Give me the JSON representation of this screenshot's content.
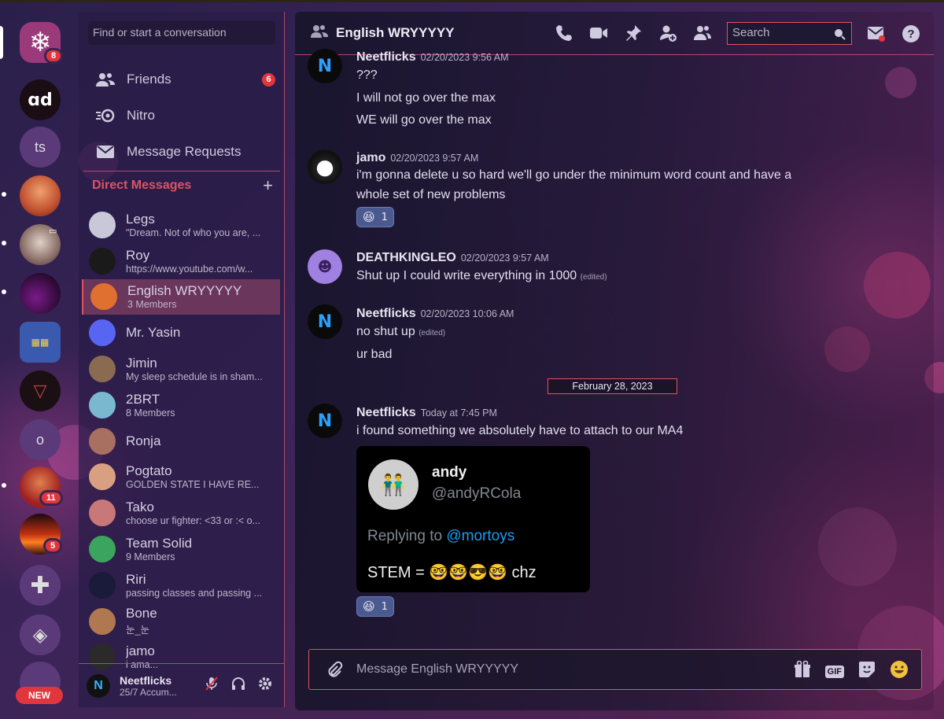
{
  "servers": {
    "home_badge": "8",
    "ts_label": "ts",
    "o_label": "o",
    "srv9_badge": "11",
    "srv10_badge": "5",
    "new_label": "NEW"
  },
  "search_placeholder": "Find or start a conversation",
  "nav": {
    "friends": "Friends",
    "friends_badge": "6",
    "nitro": "Nitro",
    "requests": "Message Requests"
  },
  "dm_header": "Direct Messages",
  "dm_plus": "+",
  "dms": [
    {
      "name": "Legs",
      "sub": "\"Dream. Not of who you are, ...",
      "color": "#c8c8d8"
    },
    {
      "name": "Roy",
      "sub": "https://www.youtube.com/w...",
      "color": "#1a1a1a"
    },
    {
      "name": "English WRYYYYY",
      "sub": "3 Members",
      "color": "#e07030"
    },
    {
      "name": "Mr. Yasin",
      "sub": "",
      "color": "#5865f2"
    },
    {
      "name": "Jimin",
      "sub": "My sleep schedule is in sham...",
      "color": "#8a6a50"
    },
    {
      "name": "2BRT",
      "sub": "8 Members",
      "color": "#7ab8d0"
    },
    {
      "name": "Ronja",
      "sub": "",
      "color": "#a87060"
    },
    {
      "name": "Pogtato",
      "sub": "GOLDEN STATE I HAVE RE...",
      "color": "#d8a080"
    },
    {
      "name": "Tako",
      "sub": "choose ur fighter: <33 or :< o...",
      "color": "#c87878"
    },
    {
      "name": "Team Solid",
      "sub": "9 Members",
      "color": "#3ba55d"
    },
    {
      "name": "Riri",
      "sub": "passing classes and passing ...",
      "color": "#1a1a3a"
    },
    {
      "name": "Bone",
      "sub": "눈_눈",
      "color": "#b07850"
    },
    {
      "name": "jamo",
      "sub": "i ama...",
      "color": "#2a2a2a"
    }
  ],
  "user": {
    "name": "Neetflicks",
    "status": "25/7 Accum..."
  },
  "channel": {
    "title": "English WRYYYYY",
    "search": "Search"
  },
  "messages": {
    "m1": {
      "author": "Neetflicks",
      "time": "02/20/2023 9:56 AM",
      "l1": "???",
      "l2": "I will not go over the max",
      "l3": "WE will go over the max"
    },
    "m2": {
      "author": "jamo",
      "time": "02/20/2023 9:57 AM",
      "l1": "i'm gonna delete u so hard we'll go under the minimum word count and have a",
      "l2": "whole set of new problems",
      "react": "1"
    },
    "m3": {
      "author": "DEATHKINGLEO",
      "time": "02/20/2023 9:57 AM",
      "l1": "Shut up I could write everything in 1000",
      "edited": "(edited)"
    },
    "m4": {
      "author": "Neetflicks",
      "time": "02/20/2023 10:06 AM",
      "l1": "no shut up",
      "edited": "(edited)",
      "l2": "ur bad"
    },
    "date_divider": "February 28, 2023",
    "m5": {
      "author": "Neetflicks",
      "time": "Today at 7:45 PM",
      "l1": "i found something we absolutely have to attach to our MA4",
      "react": "1"
    }
  },
  "tweet": {
    "name": "andy",
    "handle": "@andyRCola",
    "reply_prefix": "Replying to ",
    "reply_to": "@mortoys",
    "text": "STEM = 🤓🤓😎🤓 chz"
  },
  "composer_placeholder": "Message English WRYYYYY",
  "composer_gif": "GIF",
  "accent": "#e05262"
}
